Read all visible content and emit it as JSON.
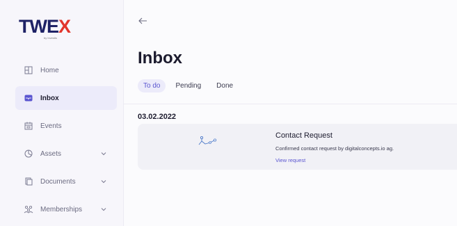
{
  "brand": {
    "logo_part1": "TWE",
    "logo_part2": "X",
    "logo_sub": "by Investis"
  },
  "sidebar": {
    "items": [
      {
        "label": "Home",
        "icon": "home-icon",
        "active": false,
        "has_chevron": false
      },
      {
        "label": "Inbox",
        "icon": "inbox-icon",
        "active": true,
        "has_chevron": false
      },
      {
        "label": "Events",
        "icon": "calendar-icon",
        "active": false,
        "has_chevron": false
      },
      {
        "label": "Assets",
        "icon": "assets-icon",
        "active": false,
        "has_chevron": true
      },
      {
        "label": "Documents",
        "icon": "documents-icon",
        "active": false,
        "has_chevron": true
      },
      {
        "label": "Memberships",
        "icon": "memberships-icon",
        "active": false,
        "has_chevron": true
      }
    ]
  },
  "main": {
    "title": "Inbox",
    "tabs": [
      {
        "label": "To do",
        "active": true
      },
      {
        "label": "Pending",
        "active": false
      },
      {
        "label": "Done",
        "active": false
      }
    ],
    "date_group": "03.02.2022",
    "request": {
      "title": "Contact Request",
      "description": "Confirmed contact request by digitalconcepts.io ag.",
      "link": "View request"
    }
  },
  "colors": {
    "accent": "#5a55d0",
    "active_bg": "#ecebfa",
    "logo_navy": "#1e2266",
    "logo_red": "#e2352c"
  }
}
